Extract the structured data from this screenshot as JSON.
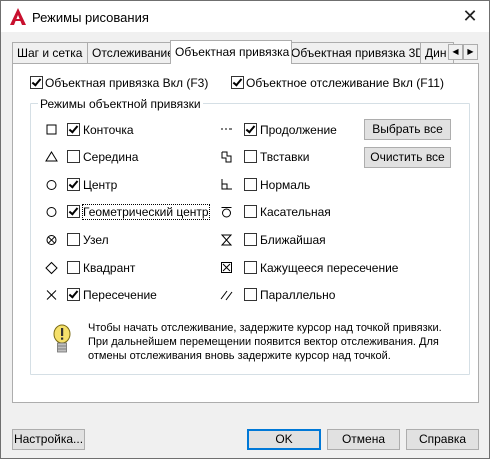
{
  "window": {
    "title": "Режимы рисования"
  },
  "tabs": [
    {
      "label": "Шаг и сетка"
    },
    {
      "label": "Отслеживание"
    },
    {
      "label": "Объектная привязка"
    },
    {
      "label": "Объектная привязка 3D"
    },
    {
      "label": "Дин"
    }
  ],
  "tab_scroll": {
    "left": "◀",
    "right": "▶"
  },
  "top_options": {
    "osnap_on": {
      "label": "Объектная привязка Вкл (F3)",
      "checked": true
    },
    "otrack_on": {
      "label": "Объектное отслеживание Вкл (F11)",
      "checked": true
    }
  },
  "group_title": "Режимы объектной привязки",
  "modes_left": [
    {
      "label": "Конточка",
      "checked": true,
      "icon": "square-marker-icon"
    },
    {
      "label": "Середина",
      "checked": false,
      "icon": "triangle-marker-icon"
    },
    {
      "label": "Центр",
      "checked": true,
      "icon": "circle-marker-icon"
    },
    {
      "label": "Геометрический центр",
      "checked": true,
      "icon": "circle-marker-icon"
    },
    {
      "label": "Узел",
      "checked": false,
      "icon": "node-marker-icon"
    },
    {
      "label": "Квадрант",
      "checked": false,
      "icon": "diamond-marker-icon"
    },
    {
      "label": "Пересечение",
      "checked": true,
      "icon": "x-marker-icon"
    }
  ],
  "modes_right": [
    {
      "label": "Продолжение",
      "checked": true,
      "icon": "extension-marker-icon"
    },
    {
      "label": "Твставки",
      "checked": false,
      "icon": "insertion-marker-icon"
    },
    {
      "label": "Нормаль",
      "checked": false,
      "icon": "perpendicular-marker-icon"
    },
    {
      "label": "Касательная",
      "checked": false,
      "icon": "tangent-marker-icon"
    },
    {
      "label": "Ближайшая",
      "checked": false,
      "icon": "nearest-marker-icon"
    },
    {
      "label": "Кажущееся пересечение",
      "checked": false,
      "icon": "apparent-intersection-marker-icon"
    },
    {
      "label": "Параллельно",
      "checked": false,
      "icon": "parallel-marker-icon"
    }
  ],
  "buttons": {
    "select_all": "Выбрать все",
    "clear_all": "Очистить все",
    "options": "Настройка...",
    "ok": "OK",
    "cancel": "Отмена",
    "help": "Справка"
  },
  "info_text": "Чтобы начать отслеживание, задержите курсор над точкой привязки. При дальнейшем перемещении появится вектор отслеживания. Для отмены отслеживания вновь задержите курсор над точкой."
}
